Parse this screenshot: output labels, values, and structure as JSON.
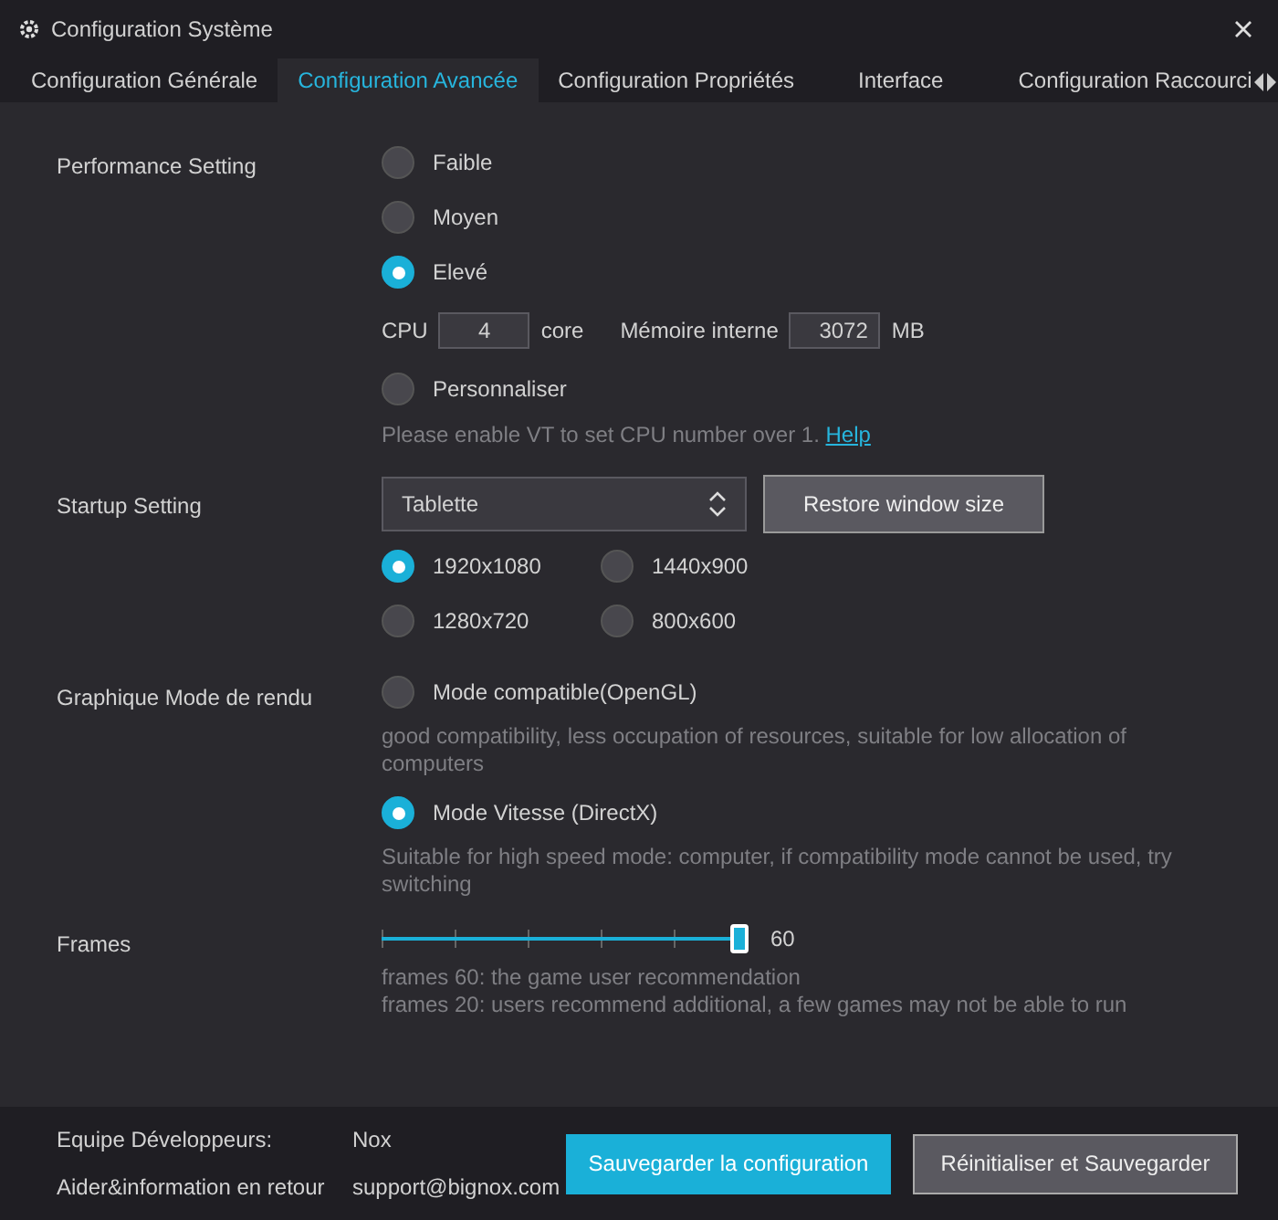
{
  "window": {
    "title": "Configuration Système"
  },
  "tabs": [
    {
      "label": "Configuration Générale",
      "selected": false
    },
    {
      "label": "Configuration Avancée",
      "selected": true
    },
    {
      "label": "Configuration Propriétés",
      "selected": false
    },
    {
      "label": "Interface",
      "selected": false
    },
    {
      "label": "Configuration Raccourci",
      "selected": false
    }
  ],
  "performance": {
    "label": "Performance Setting",
    "options": [
      {
        "label": "Faible",
        "selected": false
      },
      {
        "label": "Moyen",
        "selected": false
      },
      {
        "label": "Elevé",
        "selected": true
      }
    ],
    "cpu": {
      "label": "CPU",
      "value": "4",
      "unit": "core"
    },
    "memory": {
      "label": "Mémoire interne",
      "value": "3072",
      "unit": "MB"
    },
    "custom_option": {
      "label": "Personnaliser",
      "selected": false
    },
    "hint": {
      "text": "Please enable VT to set CPU number over 1.",
      "link": "Help"
    }
  },
  "startup": {
    "label": "Startup Setting",
    "select": {
      "value": "Tablette"
    },
    "restore_button": "Restore window size",
    "resolutions": [
      {
        "label": "1920x1080",
        "selected": true
      },
      {
        "label": "1440x900",
        "selected": false
      },
      {
        "label": "1280x720",
        "selected": false
      },
      {
        "label": "800x600",
        "selected": false
      }
    ]
  },
  "render": {
    "label": "Graphique Mode de rendu",
    "options": [
      {
        "label": "Mode compatible(OpenGL)",
        "selected": false,
        "description": "good compatibility, less occupation of resources, suitable for low allocation of computers"
      },
      {
        "label": "Mode Vitesse (DirectX)",
        "selected": true,
        "description": "Suitable for high speed mode: computer, if compatibility mode cannot be used, try switching"
      }
    ]
  },
  "frames": {
    "label": "Frames",
    "level": 1,
    "reading": "60",
    "notes": [
      "frames 60: the game user recommendation",
      "frames 20: users recommend additional, a few games may not be able to run"
    ]
  },
  "footer": {
    "rows": [
      {
        "label": "Equipe Développeurs:",
        "value": "Nox"
      },
      {
        "label": "Aider&information en retour",
        "value": "support@bignox.com"
      }
    ],
    "buttons": [
      {
        "label": "Sauvegarder la configuration",
        "kind": "primary"
      },
      {
        "label": "Réinitialiser et Sauvegarder",
        "kind": "secondary"
      }
    ]
  }
}
